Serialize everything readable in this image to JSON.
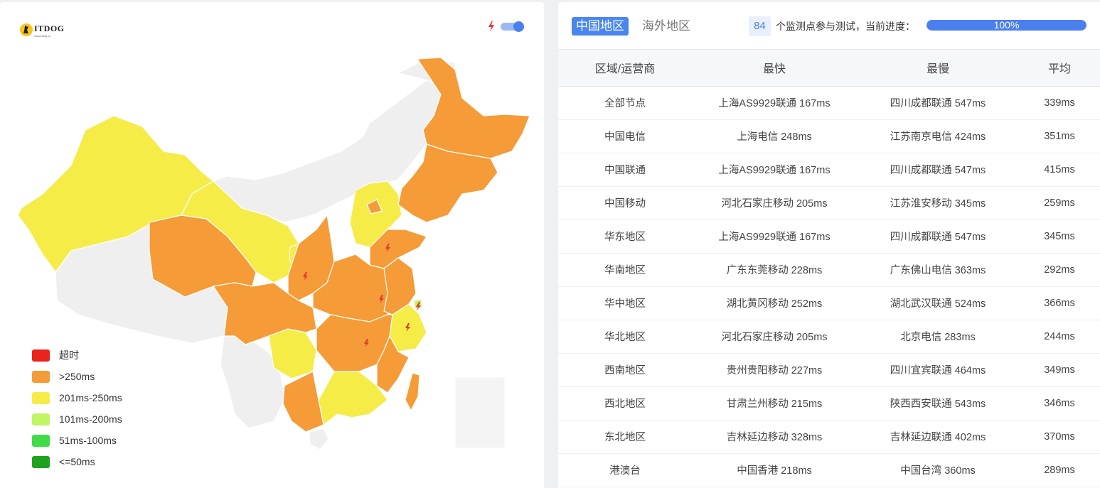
{
  "logo": {
    "name": "ITDOG",
    "sub": "www.itdog.cn"
  },
  "map": {
    "colors": {
      "orange": "#f59b37",
      "yellow": "#f5ec48",
      "grey": "#efefef",
      "border": "#ffffff",
      "bolt": "#e53935"
    }
  },
  "legend": [
    {
      "label": "超时",
      "color": "#e8241c"
    },
    {
      "label": ">250ms",
      "color": "#f59b37"
    },
    {
      "label": "201ms-250ms",
      "color": "#f5ec48"
    },
    {
      "label": "101ms-200ms",
      "color": "#c1f564"
    },
    {
      "label": "51ms-100ms",
      "color": "#3fdc47"
    },
    {
      "label": "<=50ms",
      "color": "#1fa21f"
    }
  ],
  "tabs": {
    "active": "中国地区",
    "inactive": "海外地区"
  },
  "progress": {
    "count": "84",
    "text": "个监测点参与测试，当前进度：",
    "percent_label": "100%",
    "fraction": 1.0
  },
  "table": {
    "headers": [
      "区域/运营商",
      "最快",
      "最慢",
      "平均"
    ],
    "rows": [
      [
        "全部节点",
        "上海AS9929联通 167ms",
        "四川成都联通 547ms",
        "339ms"
      ],
      [
        "中国电信",
        "上海电信 248ms",
        "江苏南京电信 424ms",
        "351ms"
      ],
      [
        "中国联通",
        "上海AS9929联通 167ms",
        "四川成都联通 547ms",
        "415ms"
      ],
      [
        "中国移动",
        "河北石家庄移动 205ms",
        "江苏淮安移动 345ms",
        "259ms"
      ],
      [
        "华东地区",
        "上海AS9929联通 167ms",
        "四川成都联通 547ms",
        "345ms"
      ],
      [
        "华南地区",
        "广东东莞移动 228ms",
        "广东佛山电信 363ms",
        "292ms"
      ],
      [
        "华中地区",
        "湖北黄冈移动 252ms",
        "湖北武汉联通 524ms",
        "366ms"
      ],
      [
        "华北地区",
        "河北石家庄移动 205ms",
        "北京电信 283ms",
        "244ms"
      ],
      [
        "西南地区",
        "贵州贵阳移动 227ms",
        "四川宜宾联通 464ms",
        "349ms"
      ],
      [
        "西北地区",
        "甘肃兰州移动 215ms",
        "陕西西安联通 543ms",
        "346ms"
      ],
      [
        "东北地区",
        "吉林延边移动 328ms",
        "吉林延边联通 402ms",
        "370ms"
      ],
      [
        "港澳台",
        "中国香港 218ms",
        "中国台湾 360ms",
        "289ms"
      ]
    ]
  }
}
